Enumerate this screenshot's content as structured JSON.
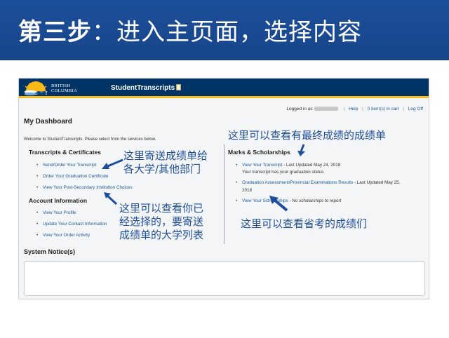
{
  "slide": {
    "title_step": "第三步",
    "title_rest": "：进入主页面，选择内容"
  },
  "header": {
    "logo_line1": "BRITISH",
    "logo_line2": "COLUMBIA",
    "app_name": "StudentTranscripts",
    "brand_color": "#003366",
    "accent_color": "#fcba19"
  },
  "userbar": {
    "logged_in_label": "Logged in as",
    "help": "Help",
    "cart": "0 item(s) in cart",
    "logoff": "Log Off"
  },
  "dashboard": {
    "title": "My Dashboard",
    "welcome": "Welcome to StudentTranscripts. Please select from the services below."
  },
  "transcripts": {
    "heading": "Transcripts & Certificates",
    "items": [
      "Send/Order Your Transcript",
      "Order Your Graduation Certificate",
      "View Your Post-Secondary Institution Choices"
    ]
  },
  "account": {
    "heading": "Account Information",
    "items": [
      "View Your Profile",
      "Update Your Contact Information",
      "View Your Order Activity"
    ]
  },
  "marks": {
    "heading": "Marks & Scholarships",
    "transcript_link": "View Your Transcript",
    "transcript_meta": " - Last Updated May 24, 2018",
    "transcript_status": "Your transcript has your graduation status",
    "assessment_link": "Graduation Assessment/Provincial Examinations Results",
    "assessment_meta_1": " - Last Updated May 25,",
    "assessment_meta_2": "2018",
    "scholarships_link": "View Your Scholarships",
    "scholarships_meta": " - No scholarships to report"
  },
  "system": {
    "title": "System Notice(s)"
  },
  "annotations": {
    "send": [
      "这里寄送成绩单给",
      "各大学/其他部门"
    ],
    "choices": [
      "这里可以查看你已",
      "经选择的，要寄送",
      "成绩单的大学列表"
    ],
    "final": "这里可以查看有最终成绩的成绩单",
    "provincial": "这里可以查看省考的成绩们"
  }
}
